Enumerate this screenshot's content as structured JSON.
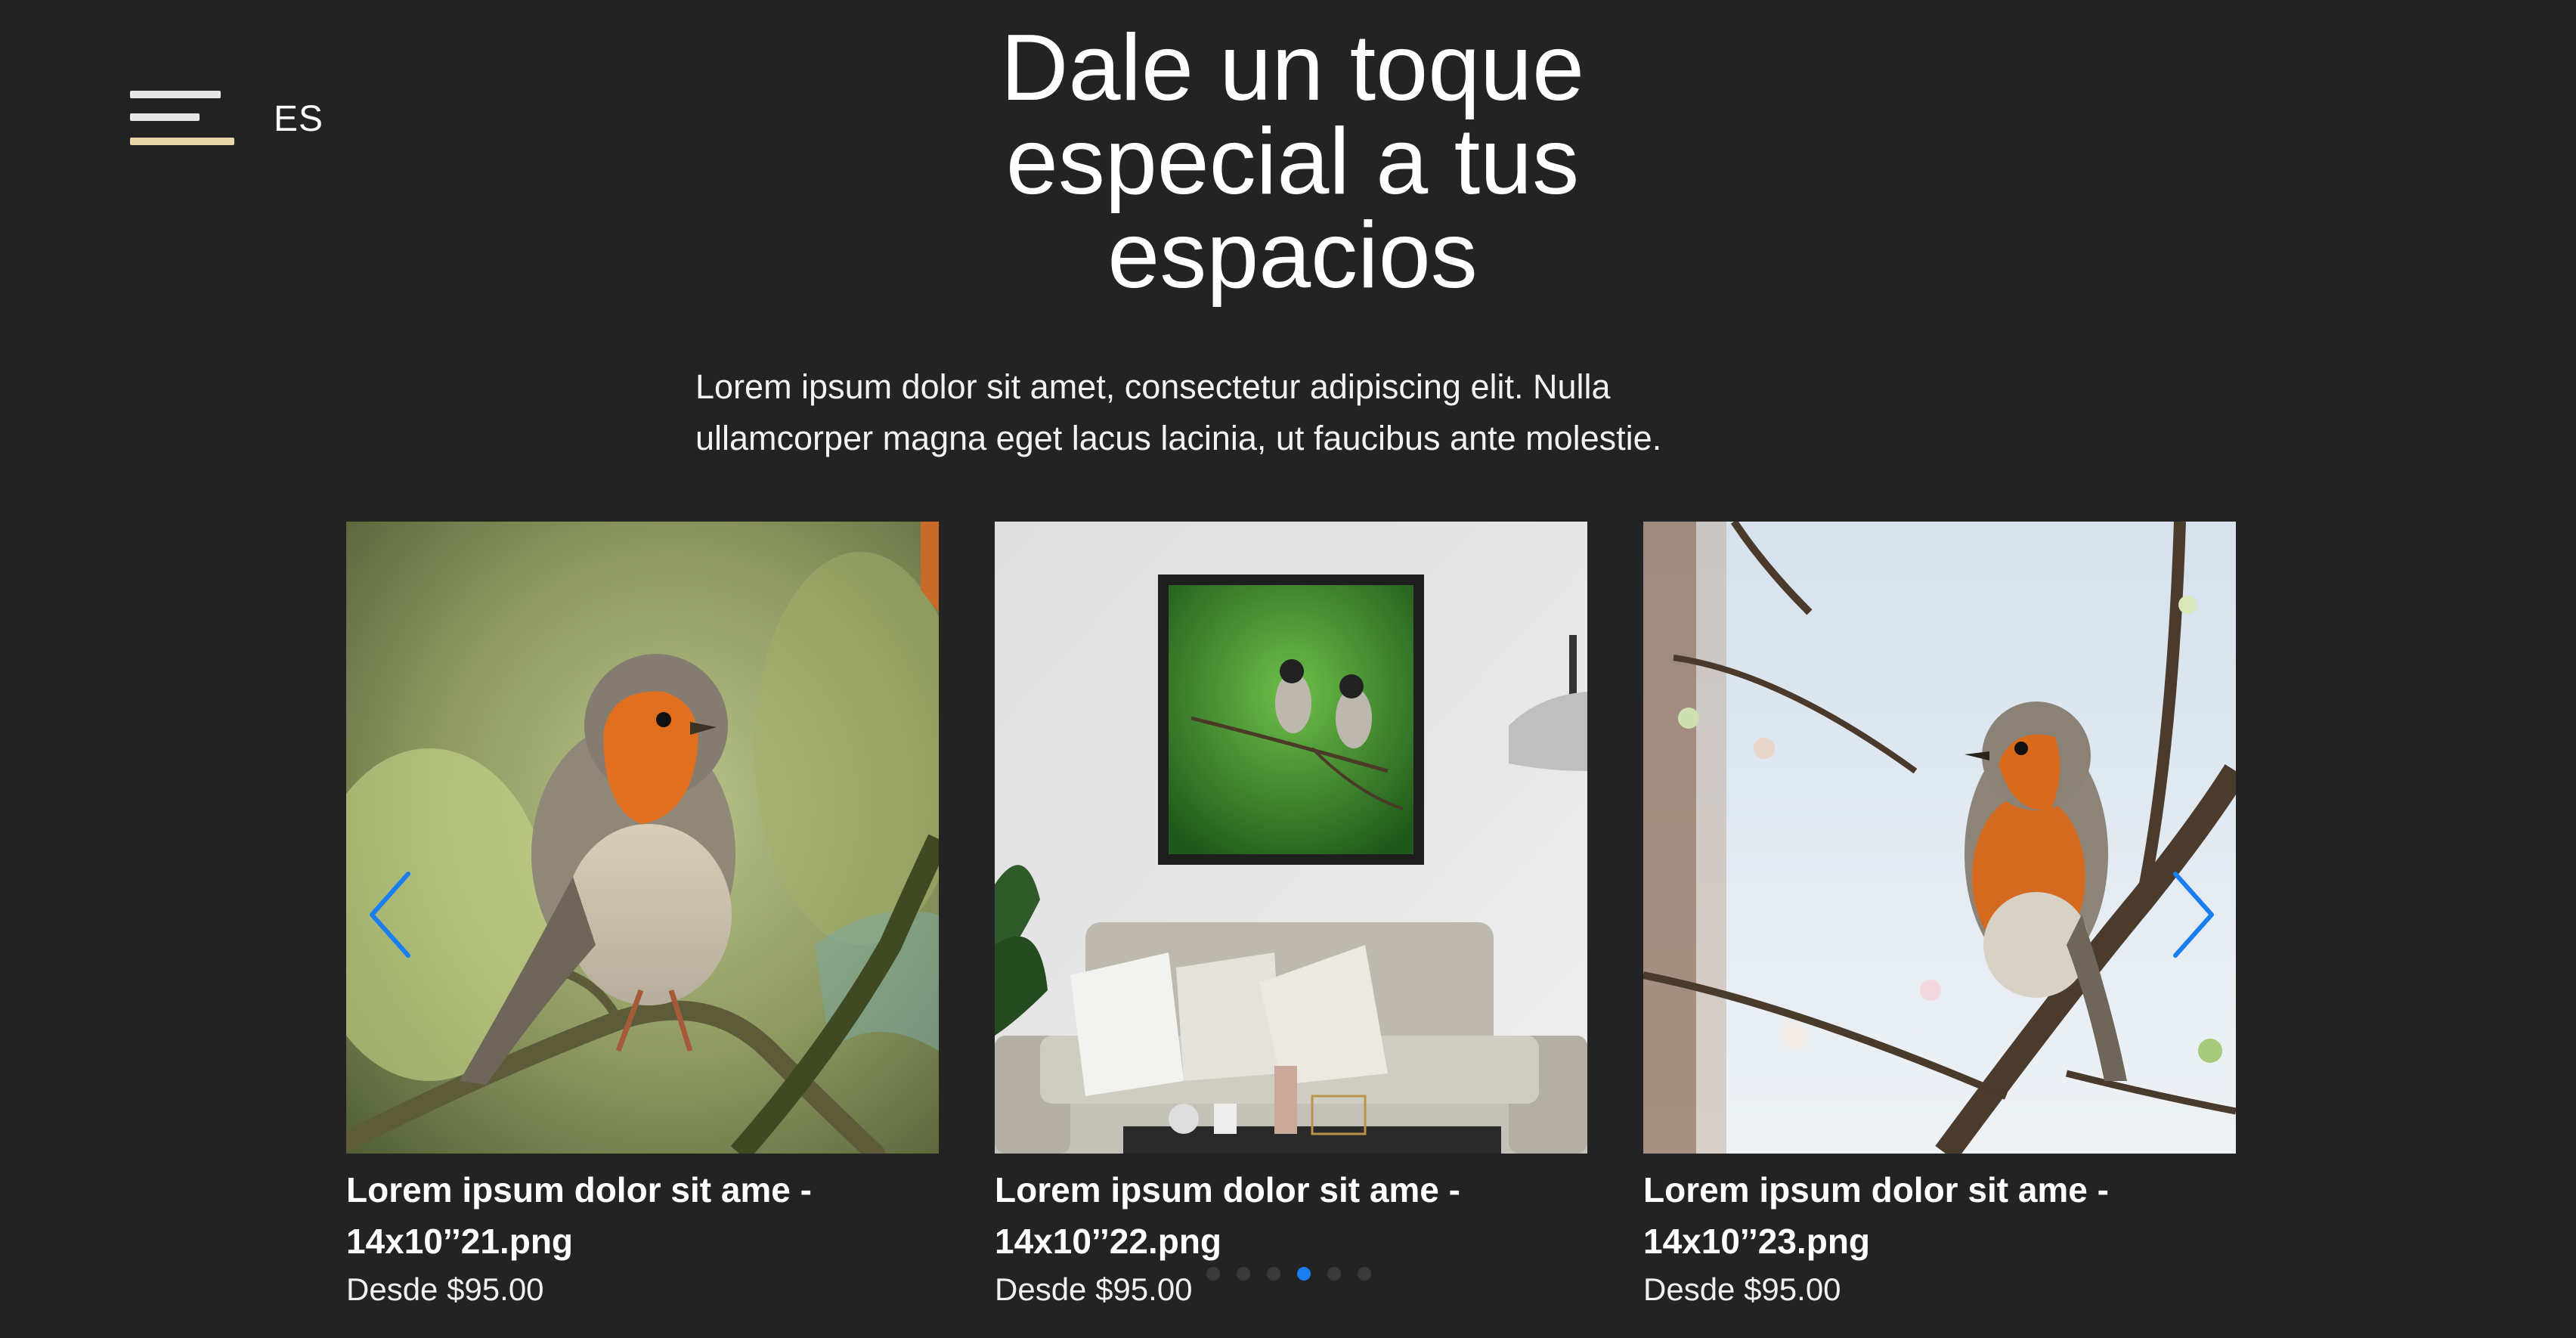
{
  "header": {
    "language": "ES"
  },
  "hero": {
    "title_line1": "Dale un toque",
    "title_line2": "especial a tus",
    "title_line3": "espacios",
    "description_line1": "Lorem ipsum dolor sit amet, consectetur adipiscing elit. Nulla",
    "description_line2": "ullamcorper magna eget lacus lacinia, ut faucibus ante molestie."
  },
  "products": [
    {
      "title_line1": "Lorem ipsum dolor sit ame -",
      "title_line2": "14x10’’21.png",
      "price": "Desde $95.00",
      "image": "robin-on-branch-photo"
    },
    {
      "title_line1": "Lorem ipsum dolor sit ame -",
      "title_line2": "14x10’’22.png",
      "price": "Desde $95.00",
      "image": "framed-birds-living-room-photo"
    },
    {
      "title_line1": "Lorem ipsum dolor sit ame -",
      "title_line2": "14x10’’23.png",
      "price": "Desde $95.00",
      "image": "robin-blossom-branch-photo"
    }
  ],
  "carousel": {
    "prev_icon": "chevron-left-icon",
    "next_icon": "chevron-right-icon",
    "dot_count": 6,
    "active_dot": 4
  },
  "colors": {
    "background": "#232323",
    "accent": "#1a7ef0",
    "menu_highlight": "#e8d7a8"
  }
}
